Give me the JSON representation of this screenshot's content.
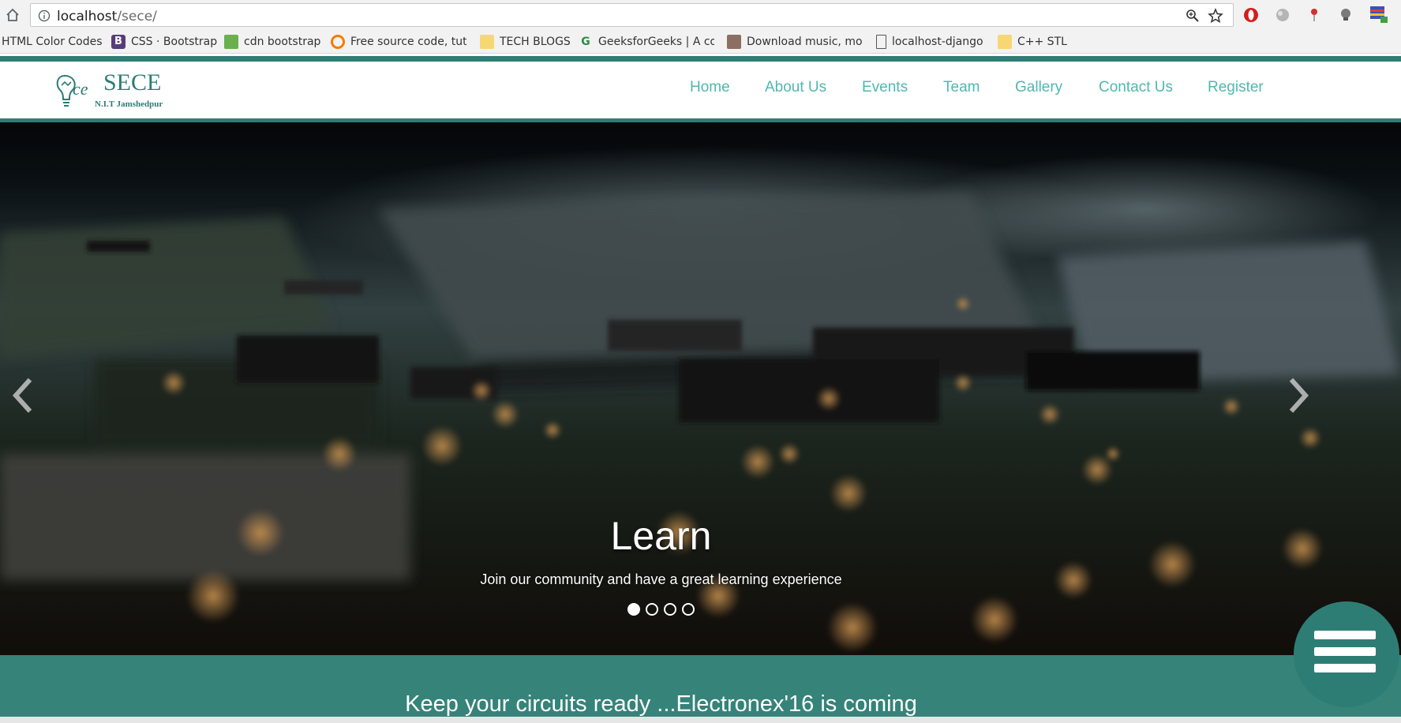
{
  "browser": {
    "url_host": "localhost",
    "url_path": "/sece/",
    "bookmarks": [
      {
        "label": "HTML Color Codes",
        "icon": "none"
      },
      {
        "label": "CSS · Bootstrap",
        "icon": "bootstrap-icon"
      },
      {
        "label": "cdn bootstrap",
        "icon": "w3-icon"
      },
      {
        "label": "Free source code, tuto",
        "icon": "codeproject-icon"
      },
      {
        "label": "TECH BLOGS",
        "icon": "folder-icon"
      },
      {
        "label": "GeeksforGeeks | A cor",
        "icon": "gfg-icon"
      },
      {
        "label": "Download music, mov",
        "icon": "download-icon"
      },
      {
        "label": "localhost-django",
        "icon": "page-icon"
      },
      {
        "label": "C++ STL",
        "icon": "folder-icon"
      }
    ]
  },
  "site": {
    "logo": {
      "name": "SECE",
      "subtitle": "N.I.T Jamshedpur",
      "mark": "ce"
    },
    "nav": [
      "Home",
      "About Us",
      "Events",
      "Team",
      "Gallery",
      "Contact Us",
      "Register"
    ],
    "colors": {
      "teal": "#2e7d75",
      "nav_text": "#4fb8b0",
      "band": "#358379"
    }
  },
  "hero": {
    "title": "Learn",
    "subtitle": "Join our community and have a great learning experience",
    "slide_count": 4,
    "active_slide": 1
  },
  "band": {
    "headline": "Keep your circuits ready ...Electronex'16 is coming"
  },
  "fab": {
    "icon": "hamburger-menu-icon"
  }
}
